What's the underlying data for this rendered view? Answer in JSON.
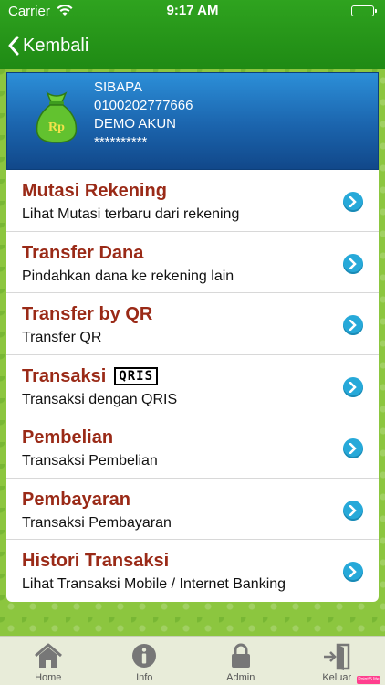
{
  "status": {
    "carrier": "Carrier",
    "time": "9:17 AM"
  },
  "nav": {
    "back_label": "Kembali"
  },
  "account": {
    "icon_label": "Rp",
    "name": "SIBAPA",
    "number": "0100202777666",
    "holder": "DEMO AKUN",
    "masked": "**********"
  },
  "menu": [
    {
      "title": "Mutasi Rekening",
      "subtitle": "Lihat Mutasi terbaru dari rekening"
    },
    {
      "title": "Transfer Dana",
      "subtitle": "Pindahkan dana ke rekening lain"
    },
    {
      "title": "Transfer by QR",
      "subtitle": "Transfer QR"
    },
    {
      "title": "Transaksi",
      "subtitle": "Transaksi dengan QRIS",
      "logo": "QRIS"
    },
    {
      "title": "Pembelian",
      "subtitle": "Transaksi Pembelian"
    },
    {
      "title": "Pembayaran",
      "subtitle": "Transaksi Pembayaran"
    },
    {
      "title": "Histori Transaksi",
      "subtitle": "Lihat Transaksi Mobile / Internet Banking"
    }
  ],
  "tabs": [
    {
      "label": "Home",
      "icon": "home-icon"
    },
    {
      "label": "Info",
      "icon": "info-icon"
    },
    {
      "label": "Admin",
      "icon": "lock-icon"
    },
    {
      "label": "Keluar",
      "icon": "logout-icon"
    }
  ],
  "badge": {
    "label": "Point 5 lite"
  },
  "colors": {
    "nav_green": "#2fa31f",
    "card_blue": "#1b64ad",
    "title_red": "#9a2a17",
    "chevron_blue": "#27a9d9"
  }
}
